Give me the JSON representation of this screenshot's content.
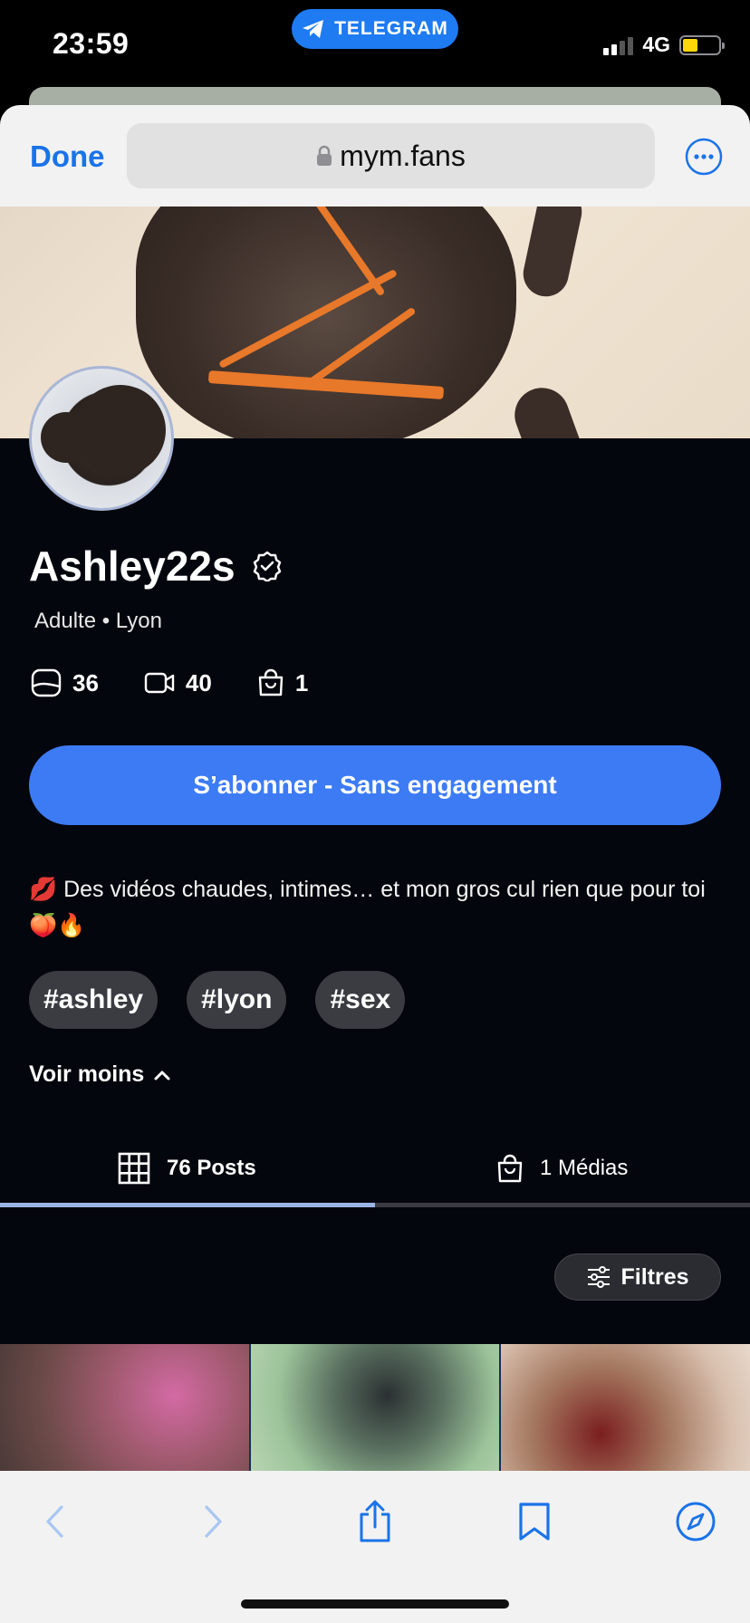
{
  "status_bar": {
    "time": "23:59",
    "back_app_label": "TELEGRAM",
    "network": "4G",
    "battery_level": 0.42,
    "signal_bars": 2
  },
  "browser": {
    "done_label": "Done",
    "url": "mym.fans",
    "accent_color": "#1a73e8"
  },
  "profile": {
    "username": "Adulte • Lyon",
    "name": "Ashley22s",
    "verified_icon": "verified-badge-icon",
    "subtitle": "Adulte • Lyon",
    "stats": [
      {
        "icon": "photo-icon",
        "value": "36"
      },
      {
        "icon": "video-icon",
        "value": "40"
      },
      {
        "icon": "bag-icon",
        "value": "1"
      }
    ],
    "subscribe_label": "S’abonner - Sans engagement",
    "subscribe_color": "#3d7bf5",
    "bio": "💋 Des vidéos chaudes, intimes… et mon gros cul rien que pour toi 🍑🔥",
    "tags": [
      "#ashley",
      "#lyon",
      "#sex"
    ],
    "toggle_label": "Voir moins"
  },
  "tabs": [
    {
      "label": "76 Posts",
      "icon": "grid-icon",
      "active": true
    },
    {
      "label": "1 Médias",
      "icon": "bag-icon",
      "active": false
    }
  ],
  "filters_label": "Filtres",
  "toolbar": {
    "icons": [
      "back-icon",
      "forward-icon",
      "share-icon",
      "bookmarks-icon",
      "compass-icon"
    ]
  }
}
